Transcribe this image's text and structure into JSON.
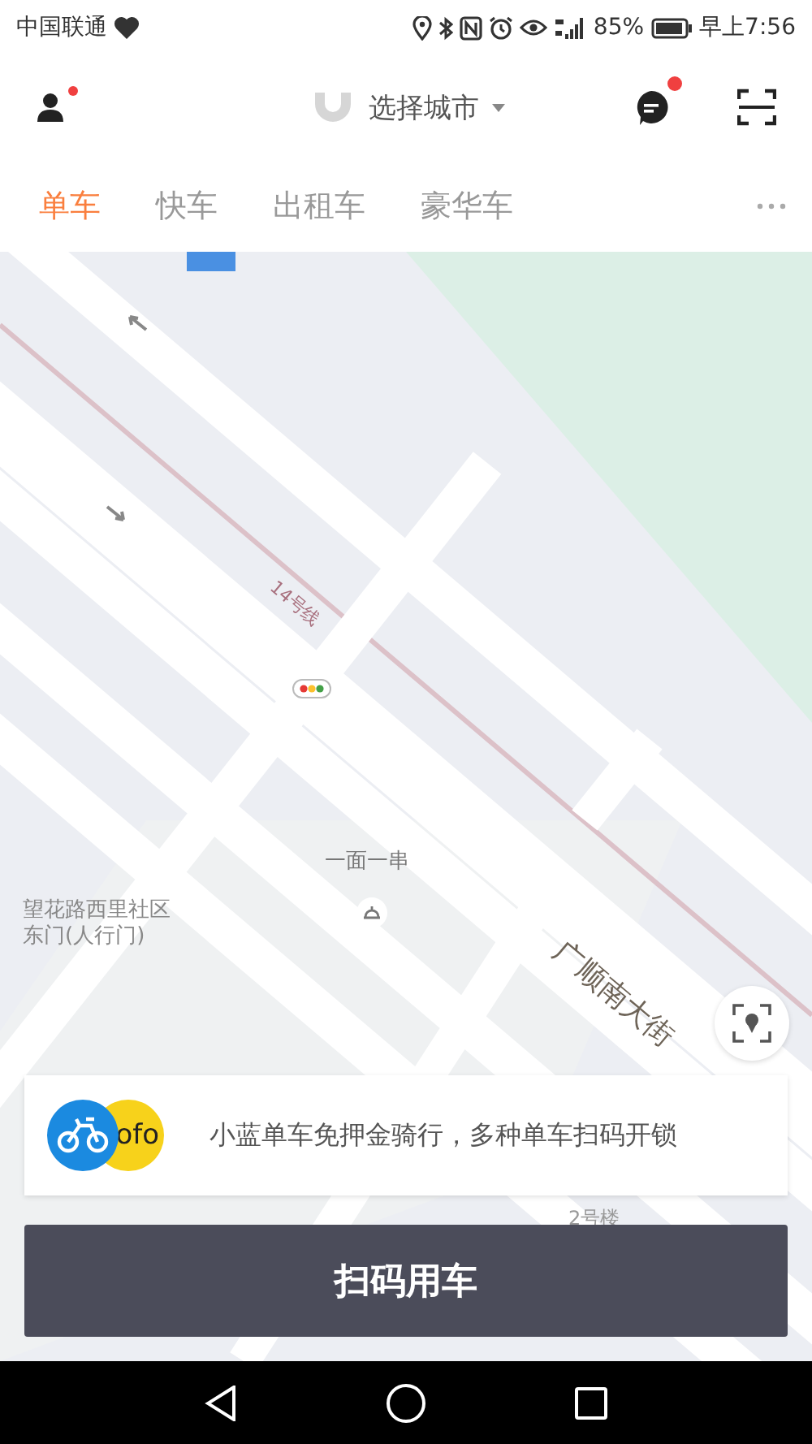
{
  "status_bar": {
    "carrier": "中国联通",
    "battery": "85%",
    "time": "早上7:56"
  },
  "header": {
    "city_picker": "选择城市",
    "profile_badge": true,
    "message_badge": true
  },
  "tabs": [
    {
      "label": "单车",
      "selected": true
    },
    {
      "label": "快车",
      "selected": false
    },
    {
      "label": "出租车",
      "selected": false
    },
    {
      "label": "豪华车",
      "selected": false
    }
  ],
  "map": {
    "labels": [
      {
        "kind": "subway",
        "text": "14号线"
      },
      {
        "kind": "poi",
        "text": "一面一串"
      },
      {
        "kind": "place",
        "lines": [
          "望花路西里社区",
          "东门(人行门)"
        ]
      },
      {
        "kind": "road",
        "text": "广顺南大街"
      },
      {
        "kind": "building",
        "text": "2号楼"
      }
    ]
  },
  "banner": {
    "logo_text": "ofo",
    "text": "小蓝单车免押金骑行，多种单车扫码开锁"
  },
  "primary_button": "扫码用车"
}
